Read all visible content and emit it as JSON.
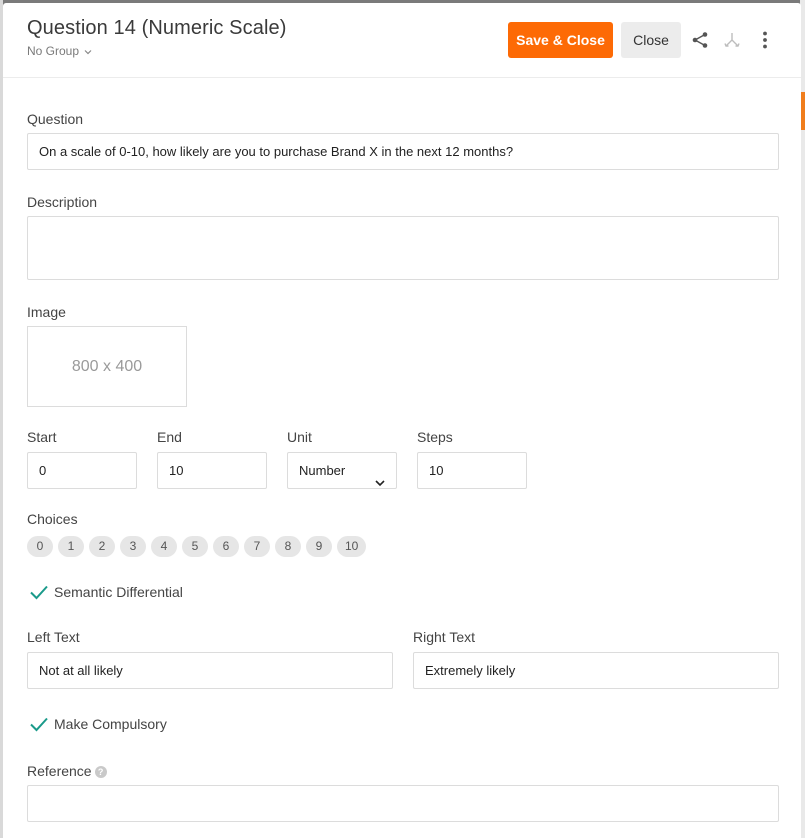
{
  "header": {
    "title": "Question 14 (Numeric Scale)",
    "group": "No Group",
    "save_label": "Save & Close",
    "close_label": "Close"
  },
  "form": {
    "question_label": "Question",
    "question_value": "On a scale of 0-10, how likely are you to purchase Brand X in the next 12 months?",
    "description_label": "Description",
    "description_value": "",
    "image_label": "Image",
    "image_placeholder": "800 x 400",
    "start_label": "Start",
    "start_value": "0",
    "end_label": "End",
    "end_value": "10",
    "unit_label": "Unit",
    "unit_value": "Number",
    "steps_label": "Steps",
    "steps_value": "10",
    "choices_label": "Choices",
    "choices": [
      "0",
      "1",
      "2",
      "3",
      "4",
      "5",
      "6",
      "7",
      "8",
      "9",
      "10"
    ],
    "semantic_label": "Semantic Differential",
    "semantic_checked": true,
    "left_text_label": "Left Text",
    "left_text_value": "Not at all likely",
    "right_text_label": "Right Text",
    "right_text_value": "Extremely likely",
    "compulsory_label": "Make Compulsory",
    "compulsory_checked": true,
    "reference_label": "Reference",
    "reference_help": "?",
    "reference_value": ""
  },
  "colors": {
    "accent": "#fd6a05",
    "check": "#1a9a8a"
  },
  "icons": [
    "chevron-down-icon",
    "share-icon",
    "merge-icon",
    "more-vertical-icon",
    "check-icon",
    "help-icon"
  ]
}
